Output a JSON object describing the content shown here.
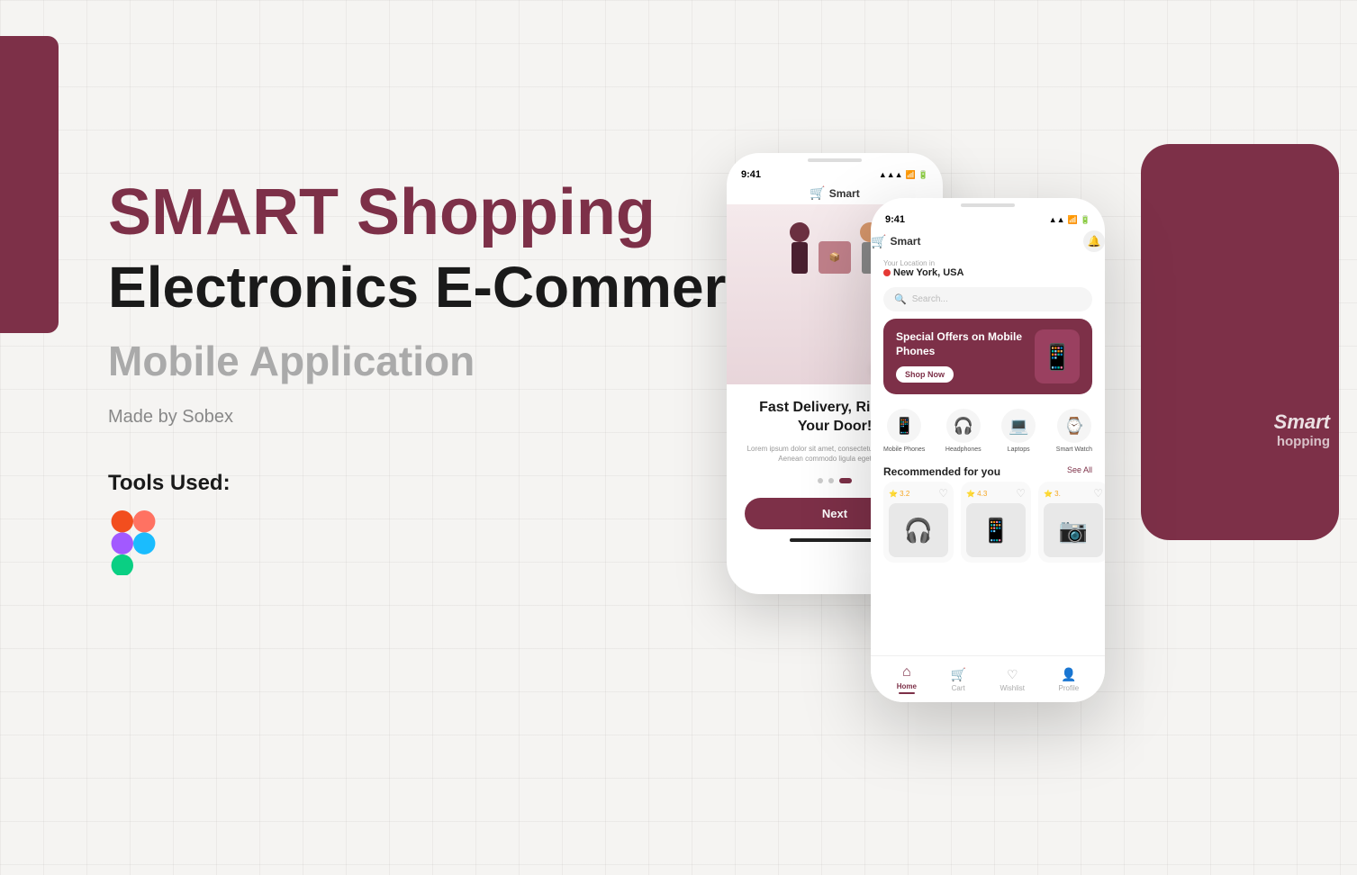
{
  "background": {
    "color": "#f5f4f2"
  },
  "left_decoration": {
    "color": "#7d3048"
  },
  "hero": {
    "title_line1": "SMART Shopping",
    "title_line2": "Electronics E-Commerce",
    "title_line3": "Mobile Application",
    "made_by": "Made by Sobex",
    "tools_label": "Tools Used:"
  },
  "phone_mid": {
    "status_time": "9:41",
    "logo": "Smart",
    "onboarding_title": "Fast Delivery, Right to Your Door!",
    "onboarding_desc": "Lorem ipsum dolor sit amet, consectetur adipiscing elit. Aenean commodo ligula eget dolor.",
    "next_button": "Next"
  },
  "phone_front": {
    "status_time": "9:41",
    "logo": "Smart",
    "location_label": "Your Location in",
    "location_value": "New York, USA",
    "search_placeholder": "Search...",
    "banner": {
      "title": "Special Offers on Mobile Phones",
      "button": "Shop Now"
    },
    "categories": [
      {
        "label": "Mobile Phones",
        "icon": "📱"
      },
      {
        "label": "Headphones",
        "icon": "🎧"
      },
      {
        "label": "Laptops",
        "icon": "💻"
      },
      {
        "label": "Smart Watch",
        "icon": "⌚"
      }
    ],
    "recommended_title": "Recommended for you",
    "see_all": "See All",
    "products": [
      {
        "rating": "3.2",
        "icon": "🎧"
      },
      {
        "rating": "4.3",
        "icon": "📱"
      },
      {
        "rating": "3.",
        "icon": "📷"
      }
    ],
    "nav_items": [
      {
        "label": "Home",
        "icon": "⌂",
        "active": true
      },
      {
        "label": "Cart",
        "icon": "🛒",
        "active": false
      },
      {
        "label": "Wishlist",
        "icon": "♡",
        "active": false
      },
      {
        "label": "Profile",
        "icon": "👤",
        "active": false
      }
    ]
  },
  "phone_back": {
    "text_line1": "Smart",
    "text_line2": "hopping"
  }
}
